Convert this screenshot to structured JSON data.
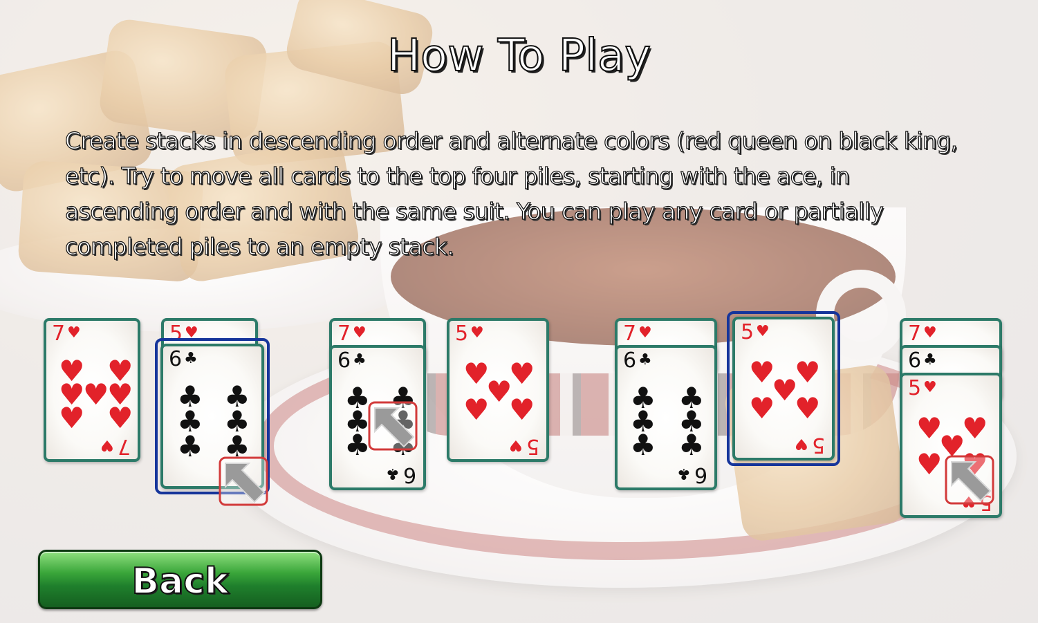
{
  "screen": {
    "title": "How To Play",
    "instructions": "Create stacks in descending order and alternate colors (red queen on black king, etc). Try to move all cards to the top four piles, starting with the ace, in ascending order and with the same suit. You can play any card or partially completed piles to an empty stack."
  },
  "cards": {
    "seven": "7",
    "six": "6",
    "five": "5",
    "heart": "♥",
    "club": "♣"
  },
  "back_button": {
    "label": "Back"
  },
  "colors": {
    "card_border": "#2c7a68",
    "selection_border": "#16359b",
    "red_suit": "#e2222a",
    "button_green": "#1f7f2c"
  },
  "icons": [
    "heart-icon",
    "club-icon",
    "pointer-arrow-icon"
  ]
}
